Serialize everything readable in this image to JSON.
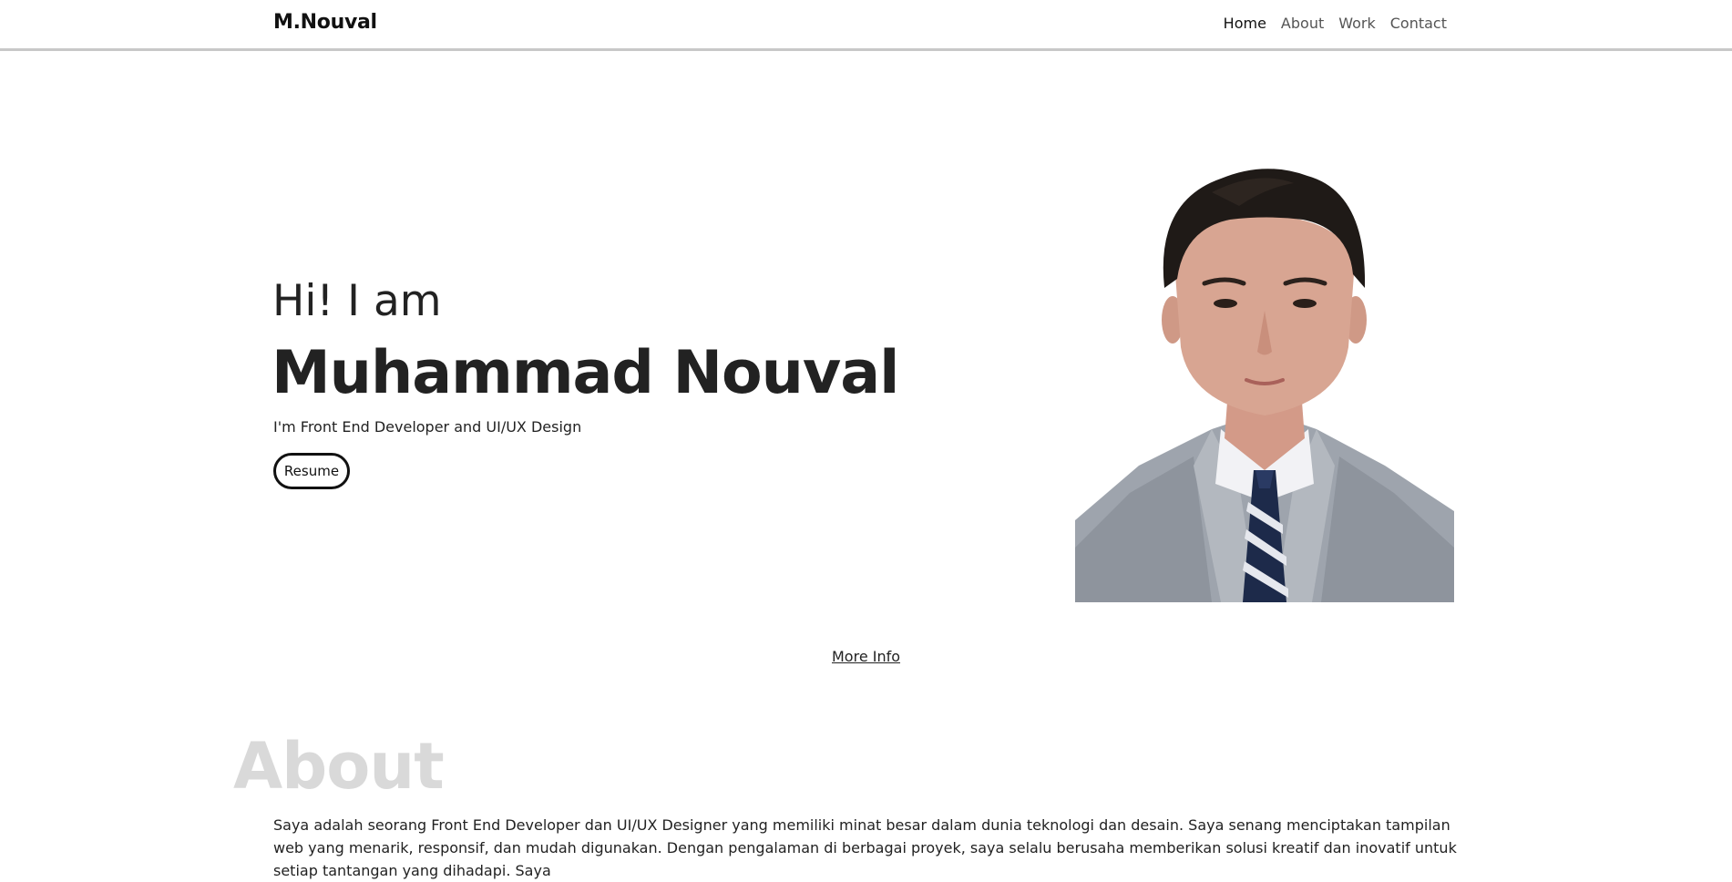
{
  "navbar": {
    "brand": "M.Nouval",
    "links": [
      {
        "label": "Home",
        "active": true
      },
      {
        "label": "About",
        "active": false
      },
      {
        "label": "Work",
        "active": false
      },
      {
        "label": "Contact",
        "active": false
      }
    ]
  },
  "hero": {
    "greeting": "Hi! I am",
    "name": "Muhammad Nouval",
    "tagline": "I'm Front End Developer and UI/UX Design",
    "resume_label": "Resume",
    "photo_icon": "portrait-photo"
  },
  "more_info_label": "More Info",
  "about": {
    "heading": "About",
    "text": "Saya adalah seorang Front End Developer dan UI/UX Designer yang memiliki minat besar dalam dunia teknologi dan desain. Saya senang menciptakan tampilan web yang menarik, responsif, dan mudah digunakan. Dengan pengalaman di berbagai proyek, saya selalu berusaha memberikan solusi kreatif dan inovatif untuk setiap tantangan yang dihadapi. Saya"
  },
  "colors": {
    "text": "#212529",
    "about_heading": "#d9d9d9",
    "nav_border": "#c8c8c8",
    "suit": "#9ea4ad",
    "skin": "#d8a592",
    "hair": "#1f1a17"
  }
}
